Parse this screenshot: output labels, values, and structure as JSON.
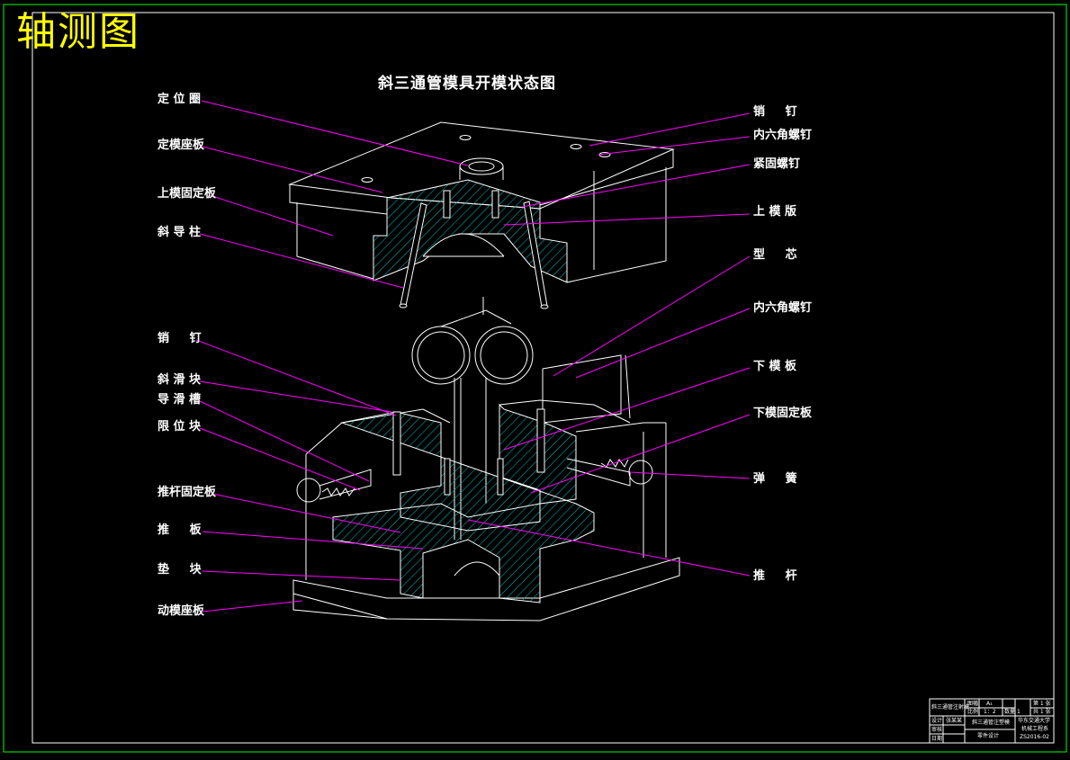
{
  "corner_title": "轴测图",
  "main_title": "斜三通管模具开模状态图",
  "labels_left": [
    {
      "id": "dingweiquan",
      "text": "定 位 圈"
    },
    {
      "id": "dingmozuoban",
      "text": "定模座板"
    },
    {
      "id": "shangmogudingban",
      "text": "上模固定板"
    },
    {
      "id": "xiedaozhu",
      "text": "斜 导 柱"
    },
    {
      "id": "xiaoding-lower",
      "text": "销     钉"
    },
    {
      "id": "xiehuakuai",
      "text": "斜 滑 块"
    },
    {
      "id": "daohuacao",
      "text": "导 滑 槽"
    },
    {
      "id": "xianweikuai",
      "text": "限 位 块"
    },
    {
      "id": "tuigangudingban",
      "text": "推杆固定板"
    },
    {
      "id": "tuiban",
      "text": "推     板"
    },
    {
      "id": "dianluai",
      "text": "垫     块"
    },
    {
      "id": "dongmozuoban",
      "text": "动模座板"
    }
  ],
  "labels_right": [
    {
      "id": "xiaoding-upper",
      "text": "销     钉"
    },
    {
      "id": "neiliujiaoluoding-upper",
      "text": "内六角螺钉"
    },
    {
      "id": "jinguluoding",
      "text": "紧固螺钉"
    },
    {
      "id": "shangmoban",
      "text": "上 模 版"
    },
    {
      "id": "xingxin",
      "text": "型     芯"
    },
    {
      "id": "neiliujiaoluoding-lower",
      "text": "内六角螺钉"
    },
    {
      "id": "xiamoban",
      "text": "下 模 板"
    },
    {
      "id": "xiamogudingban",
      "text": "下模固定板"
    },
    {
      "id": "tanhuang",
      "text": "弹     簧"
    },
    {
      "id": "tuigan",
      "text": "推     杆"
    }
  ],
  "title_block": {
    "left_name": "斜三通管注射模",
    "drawing_name": "斜三通管注塑模",
    "sheet_label": "图幅",
    "sheet_value": "A₃",
    "scale_label": "比例",
    "scale_value": "1：2",
    "count_label": "数量",
    "count_value": "1",
    "page_a": "第 1 张",
    "page_b": "共 1 张",
    "school": "华东交通大学",
    "dept": "机械工程系",
    "code": "ZS2016-02",
    "rows": [
      "设计",
      "审核",
      "日期"
    ],
    "sign": "张某某",
    "sub_name": "零件设计"
  },
  "colors": {
    "frame": "#00ff00",
    "line": "#ffffff",
    "leader": "#ff00ff",
    "hatch": "#00c0c0",
    "title": "#ffff00"
  }
}
